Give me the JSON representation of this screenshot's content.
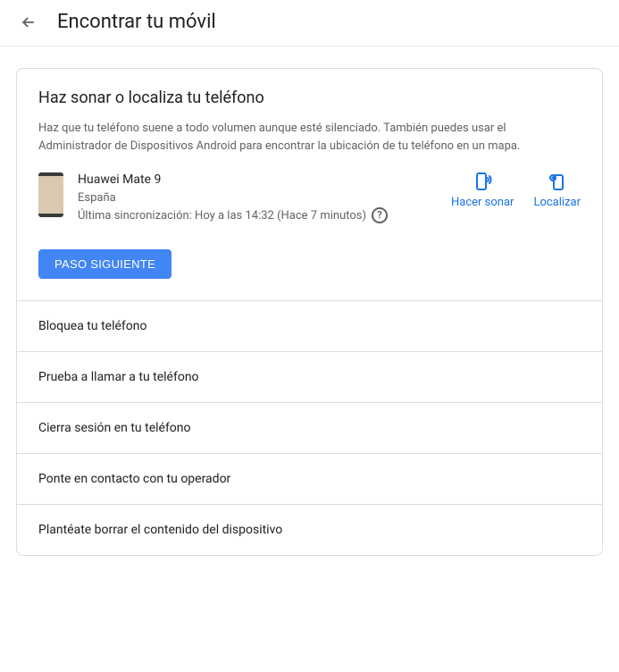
{
  "header": {
    "title": "Encontrar tu móvil"
  },
  "expanded": {
    "title": "Haz sonar o localiza tu teléfono",
    "description": "Haz que tu teléfono suene a todo volumen aunque esté silenciado. También puedes usar el Administrador de Dispositivos Android para encontrar la ubicación de tu teléfono en un mapa.",
    "device": {
      "name": "Huawei Mate 9",
      "location": "España",
      "sync": "Última sincronización: Hoy a las 14:32 (Hace 7 minutos)"
    },
    "actions": {
      "ring": "Hacer sonar",
      "locate": "Localizar"
    },
    "next_button": "PASO SIGUIENTE"
  },
  "collapsed_items": [
    "Bloquea tu teléfono",
    "Prueba a llamar a tu teléfono",
    "Cierra sesión en tu teléfono",
    "Ponte en contacto con tu operador",
    "Plantéate borrar el contenido del dispositivo"
  ]
}
